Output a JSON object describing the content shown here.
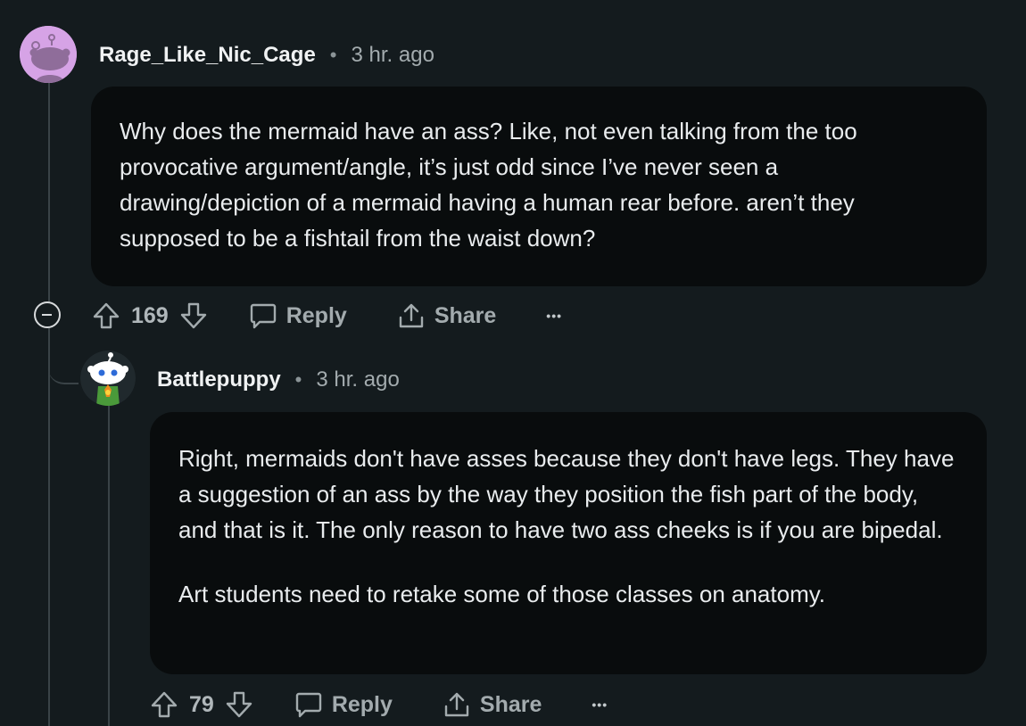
{
  "comment1": {
    "author": "Rage_Like_Nic_Cage",
    "separator": "•",
    "time": "3 hr. ago",
    "body": "Why does the mermaid have an ass? Like, not even talking from the too provocative argument/angle, it’s just odd since I’ve never seen a drawing/depiction of a mermaid having a human rear before. aren’t they supposed to be a fishtail from the waist down?",
    "votes": "169",
    "reply_label": "Reply",
    "share_label": "Share",
    "more_label": "•••"
  },
  "comment2": {
    "author": "Battlepuppy",
    "separator": "•",
    "time": "3 hr. ago",
    "body_paragraphs": [
      "Right, mermaids don't have asses because they don't have legs. They have a suggestion of an ass by the way they position the fish part of the body, and that is it. The only reason to have two ass cheeks is if you are bipedal.",
      "Art students need to retake some of those classes on anatomy."
    ],
    "votes": "79",
    "reply_label": "Reply",
    "share_label": "Share",
    "more_label": "•••"
  },
  "icons": {
    "upvote": "upvote-arrow-icon",
    "downvote": "downvote-arrow-icon",
    "reply": "speech-bubble-icon",
    "share": "share-upload-icon",
    "more": "ellipsis-icon",
    "collapse": "collapse-minus-icon"
  },
  "colors": {
    "background": "#141b1e",
    "bubble": "#090c0d",
    "avatar1": "#d6a3e6"
  }
}
